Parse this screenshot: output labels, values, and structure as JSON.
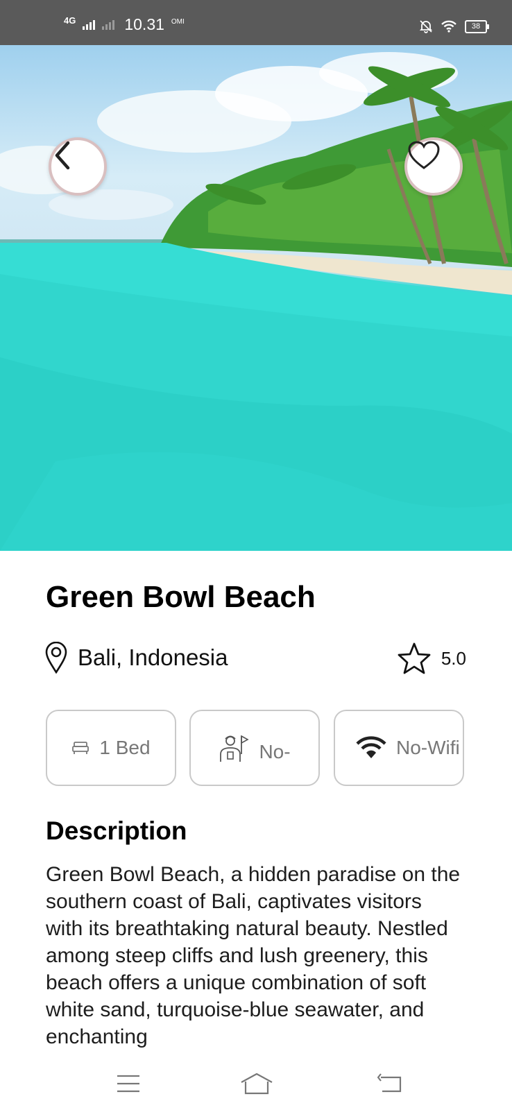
{
  "status_bar": {
    "network": "4G",
    "time": "10.31",
    "carrier_tag": "OMI",
    "battery": "38"
  },
  "hero": {
    "back_icon": "chevron-left-icon",
    "favorite_icon": "heart-icon"
  },
  "place": {
    "title": "Green Bowl Beach",
    "location": "Bali, Indonesia",
    "rating": "5.0"
  },
  "amenities": [
    {
      "icon": "bed-icon",
      "label": "1 Bed"
    },
    {
      "icon": "tour-guide-icon",
      "label": "No-"
    },
    {
      "icon": "wifi-icon",
      "label": "No-Wifi"
    }
  ],
  "description": {
    "heading": "Description",
    "text": "Green Bowl Beach, a hidden paradise on the southern coast of Bali, captivates visitors with its breathtaking natural beauty. Nestled among steep cliffs and lush greenery, this beach offers a unique combination of soft white sand, turquoise-blue seawater, and enchanting"
  },
  "colors": {
    "status_bar": "#5a5a5a",
    "sea": "#35e0d8",
    "chip_border": "#c9c9c9",
    "button_ring": "#d9bfc0"
  }
}
